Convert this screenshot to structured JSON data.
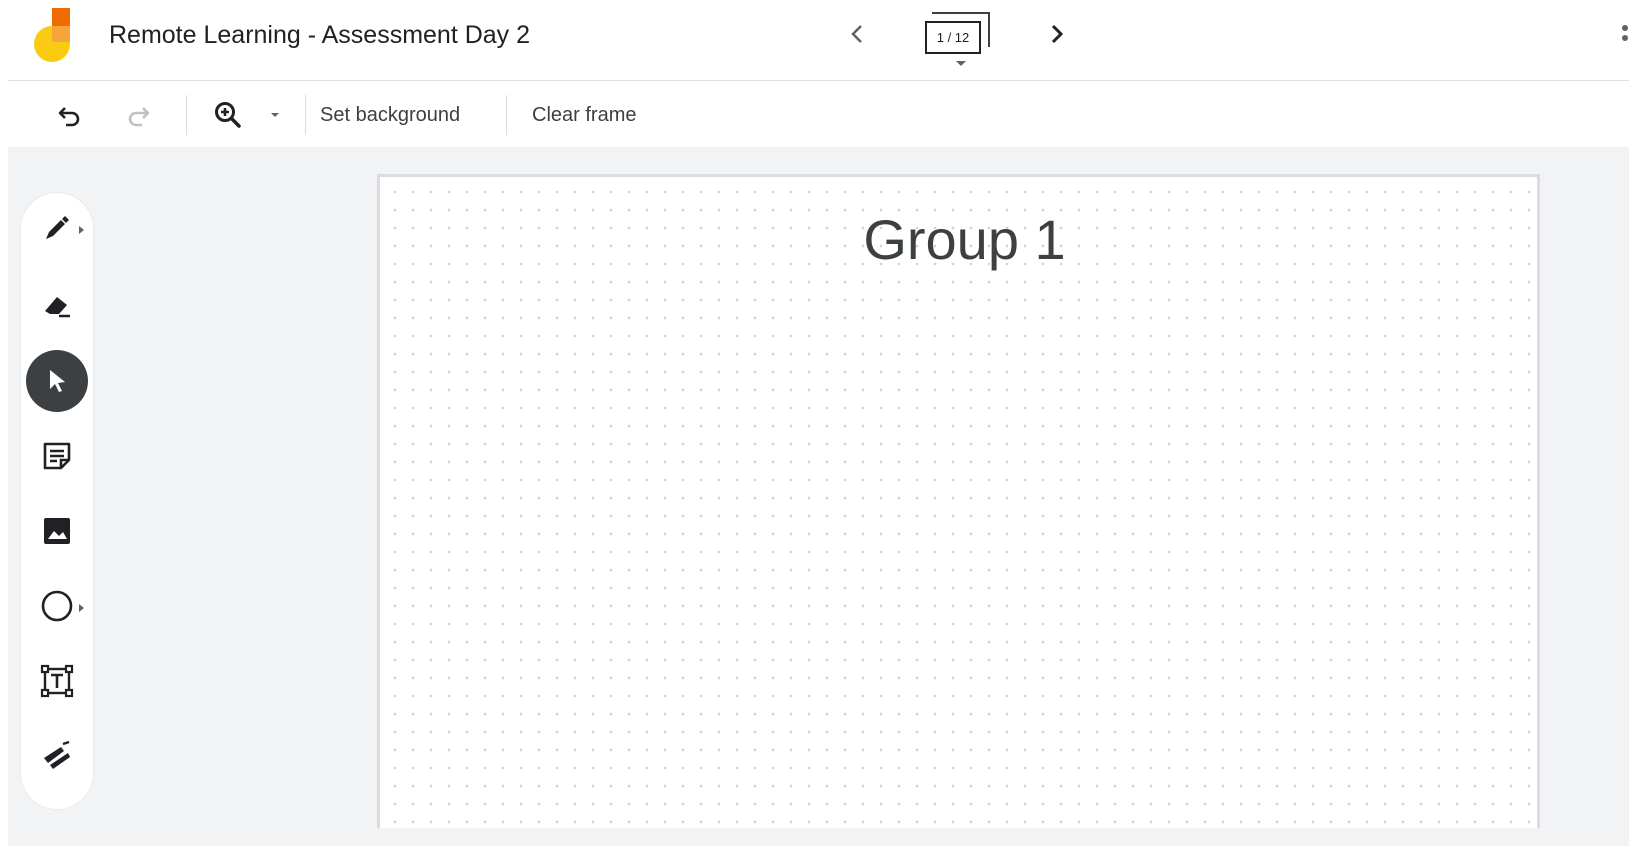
{
  "header": {
    "doc_title": "Remote Learning - Assessment Day 2",
    "frame_counter": "1 / 12",
    "prev_icon": "chevron-left-icon",
    "next_icon": "chevron-right-icon",
    "more_icon": "more-vert-icon"
  },
  "toolbar": {
    "undo_icon": "undo-icon",
    "redo_icon": "redo-icon",
    "zoom_icon": "zoom-in-icon",
    "zoom_dropdown_icon": "caret-down-icon",
    "set_background_label": "Set background",
    "clear_frame_label": "Clear frame"
  },
  "tools": [
    {
      "name": "pen",
      "icon": "pen-icon",
      "active": false
    },
    {
      "name": "eraser",
      "icon": "eraser-icon",
      "active": false
    },
    {
      "name": "select",
      "icon": "pointer-icon",
      "active": true
    },
    {
      "name": "sticky-note",
      "icon": "sticky-note-icon",
      "active": false
    },
    {
      "name": "image",
      "icon": "image-icon",
      "active": false
    },
    {
      "name": "circle",
      "icon": "circle-icon",
      "active": false
    },
    {
      "name": "text-box",
      "icon": "text-box-icon",
      "active": false
    },
    {
      "name": "laser",
      "icon": "laser-icon",
      "active": false
    }
  ],
  "canvas": {
    "title": "Group 1"
  },
  "colors": {
    "logo_yellow": "#FBCB11",
    "logo_orange": "#F28C28",
    "logo_deep_orange": "#EF6C00",
    "active_tool_bg": "#3C4043",
    "workspace_bg": "#F1F3F4"
  }
}
